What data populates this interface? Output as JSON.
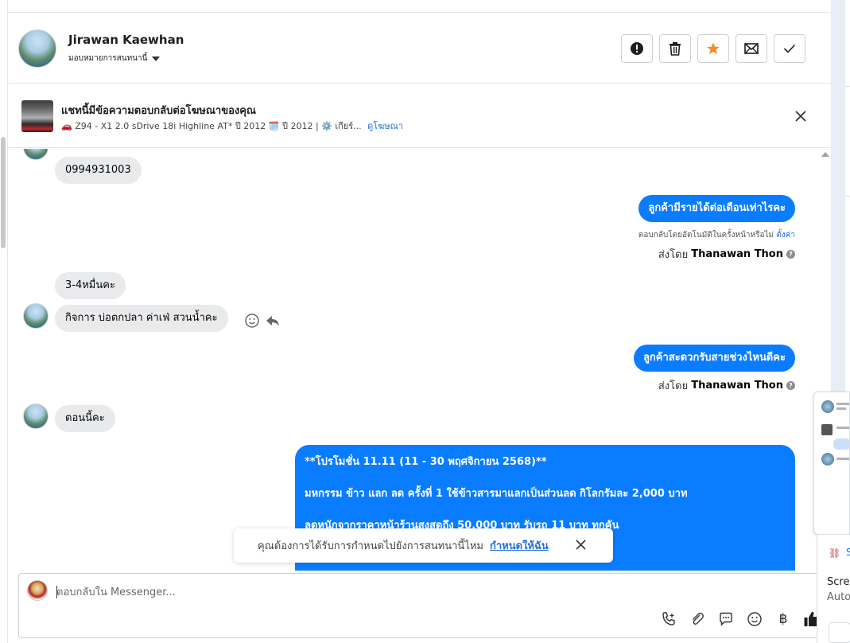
{
  "header": {
    "contact_name": "Jirawan Kaewhan",
    "assign_label": "มอบหมายการสนทนานี้",
    "buttons": [
      {
        "name": "report-button",
        "icon": "exclamation-icon"
      },
      {
        "name": "delete-button",
        "icon": "trash-icon"
      },
      {
        "name": "star-button",
        "icon": "star-icon",
        "color": "#f28c28"
      },
      {
        "name": "mark-unread-button",
        "icon": "envelope-icon"
      },
      {
        "name": "mark-done-button",
        "icon": "check-icon"
      }
    ]
  },
  "ad_banner": {
    "title": "แชทนี้มีข้อความตอบกลับต่อโฆษณาของคุณ",
    "subtitle": "🚗 Z94 - X1 2.0 sDrive 18i Highline AT* ปี 2012 🗓️ ปี 2012 | ⚙️ เกียร์...",
    "link": "ดูโฆษณา"
  },
  "messages": [
    {
      "dir": "in",
      "text": "0994931003"
    },
    {
      "dir": "out",
      "text": "ลูกค้ามีรายได้ต่อเดือนเท่าไรคะ"
    },
    {
      "auto_reply_note": "ตอบกลับโดยอัตโนมัติในครั้งหน้าหรือไม่",
      "auto_reply_link": "ตั้งค่า"
    },
    {
      "sent_by_label": "ส่งโดย",
      "sent_by_name": "Thanawan Thon"
    },
    {
      "dir": "in",
      "text": "3-4หมื่นคะ"
    },
    {
      "dir": "in",
      "text": "กิจการ  บ่อตกปลา  ค่าเฟ่  สวนน้ำคะ"
    },
    {
      "dir": "out",
      "text": "ลูกค้าสะดวกรับสายช่วงไหนดีคะ"
    },
    {
      "sent_by_label": "ส่งโดย",
      "sent_by_name": "Thanawan Thon"
    },
    {
      "dir": "in",
      "text": "ตอนนี้คะ"
    }
  ],
  "promo": {
    "line1": "**โปรโมชั่น 11.11  (11 - 30 พฤศจิกายน 2568)**",
    "line2": "มหกรรม ข้าว แลก ลด ครั้งที่ 1 ใช้ข้าวสารมาแลกเป็นส่วนลด กิโลกรัมละ 2,000 บาท",
    "line3": "ลดหนักจากราคาหน้าร้านสูงสุดถึง 50,000 บาท รับรถ 11 บาท ทุกคัน"
  },
  "toast": {
    "text": "คุณต้องการได้รับการกำหนดไปยังการสนทนานี้ไหม",
    "link": "กำหนดให้ฉัน"
  },
  "composer": {
    "placeholder": "ตอบกลับใน Messenger...",
    "tools": [
      "phone-icon",
      "paperclip-icon",
      "chat-bubble-icon",
      "emoji-icon",
      "baht-icon",
      "thumbs-up-icon"
    ]
  },
  "side_panel": {
    "letter": "S",
    "line1": "Scree",
    "line2": "Auto"
  },
  "colors": {
    "accent": "#0a7cff",
    "link": "#216fdb",
    "star": "#f28c28",
    "bubble_in": "#e9eaec"
  }
}
